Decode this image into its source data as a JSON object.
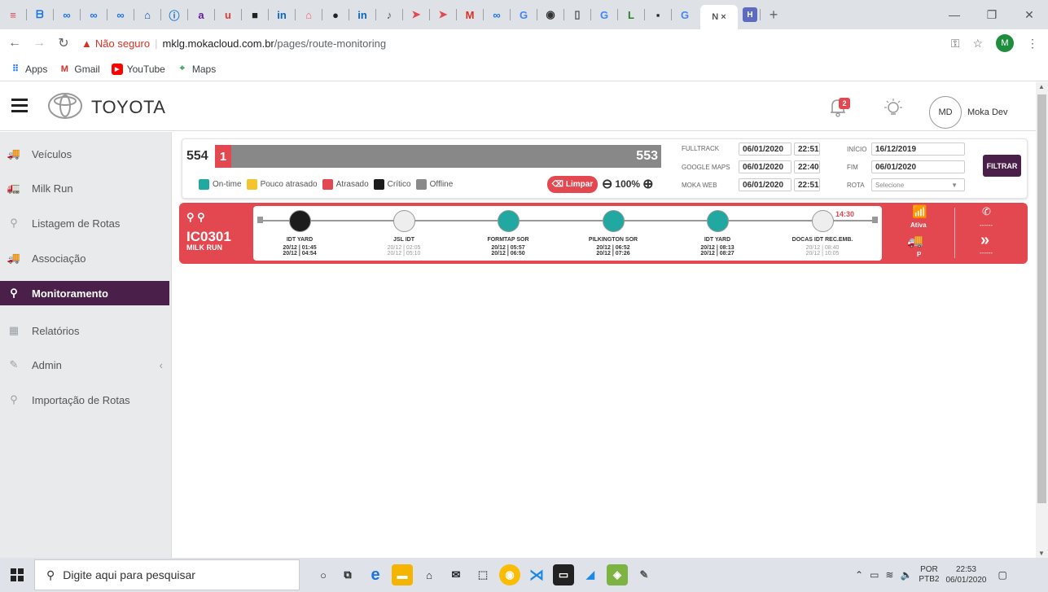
{
  "browser": {
    "url_warning": "Não seguro",
    "url_host": "mklg.mokacloud.com.br",
    "url_path": "/pages/route-monitoring",
    "profile_initial": "M",
    "bookmarks": [
      {
        "label": "Apps"
      },
      {
        "label": "Gmail"
      },
      {
        "label": "YouTube"
      },
      {
        "label": "Maps"
      }
    ]
  },
  "header": {
    "brand": "TOYOTA",
    "notification_count": "2",
    "avatar_initials": "MD",
    "username": "Moka Dev"
  },
  "sidebar": {
    "items": [
      {
        "label": "Veículos"
      },
      {
        "label": "Milk Run"
      },
      {
        "label": "Listagem de Rotas"
      },
      {
        "label": "Associação"
      },
      {
        "label": "Monitoramento"
      },
      {
        "label": "Relatórios"
      },
      {
        "label": "Admin"
      },
      {
        "label": "Importação de Rotas"
      }
    ]
  },
  "status": {
    "total": "554",
    "red_count": "1",
    "grey_count": "553",
    "legend": [
      {
        "label": "On-time",
        "color": "#20a8a1"
      },
      {
        "label": "Pouco atrasado",
        "color": "#f4c430"
      },
      {
        "label": "Atrasado",
        "color": "#e34850"
      },
      {
        "label": "Crítico",
        "color": "#1c1c1c"
      },
      {
        "label": "Offline",
        "color": "#8a8a8a"
      }
    ],
    "clear_label": "Limpar",
    "zoom_level": "100%"
  },
  "sources": {
    "fulltrack_label": "FULLTRACK",
    "fulltrack_date": "06/01/2020",
    "fulltrack_time": "22:51",
    "google_label": "GOOGLE MAPS",
    "google_date": "06/01/2020",
    "google_time": "22:40",
    "moka_label": "MOKA WEB",
    "moka_date": "06/01/2020",
    "moka_time": "22:51"
  },
  "filters": {
    "start_label": "INÍCIO",
    "start_value": "16/12/2019",
    "end_label": "FIM",
    "end_value": "06/01/2020",
    "route_label": "ROTA",
    "route_value": "Selecione",
    "filter_button": "FILTRAR"
  },
  "route": {
    "id": "IC0301",
    "type": "MILK RUN",
    "status_label": "Ativa",
    "parking_label": "P",
    "dashes_top": "------",
    "dashes_bottom": "------",
    "timeline_time": "14:30",
    "stops": [
      {
        "name": "IDT YARD",
        "t1": "20/12 | 01:45",
        "t2": "20/12 | 04:54",
        "status": "critical"
      },
      {
        "name": "JSL IDT",
        "t1": "20/12 | 02:05",
        "t2": "20/12 | 05:10",
        "status": "pending"
      },
      {
        "name": "FORMTAP SOR",
        "t1": "20/12 | 05:57",
        "t2": "20/12 | 06:50",
        "status": "ontime"
      },
      {
        "name": "PILKINGTON SOR",
        "t1": "20/12 | 06:52",
        "t2": "20/12 | 07:26",
        "status": "ontime"
      },
      {
        "name": "IDT YARD",
        "t1": "20/12 | 08:13",
        "t2": "20/12 | 08:27",
        "status": "ontime"
      },
      {
        "name": "DOCAS IDT REC.EMB.",
        "t1": "20/12 | 08:40",
        "t2": "20/12 | 10:05",
        "status": "pending"
      }
    ]
  },
  "taskbar": {
    "search_placeholder": "Digite aqui para pesquisar",
    "lang_1": "POR",
    "lang_2": "PTB2",
    "clock_time": "22:53",
    "clock_date": "06/01/2020"
  },
  "colors": {
    "accent": "#4a1f49",
    "late": "#e34850",
    "ontime": "#20a8a1",
    "critical": "#1c1c1c"
  }
}
